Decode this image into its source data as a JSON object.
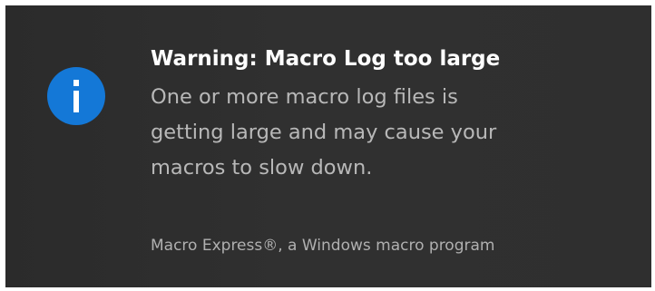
{
  "notification": {
    "icon": "info-icon",
    "accent_color": "#1478d7",
    "background_color": "#2d2d2d",
    "title": "Warning: Macro Log too large",
    "body": "One or more macro log files is\ngetting large and may cause your\nmacros to slow down.",
    "attribution": "Macro Express®, a Windows macro program"
  }
}
